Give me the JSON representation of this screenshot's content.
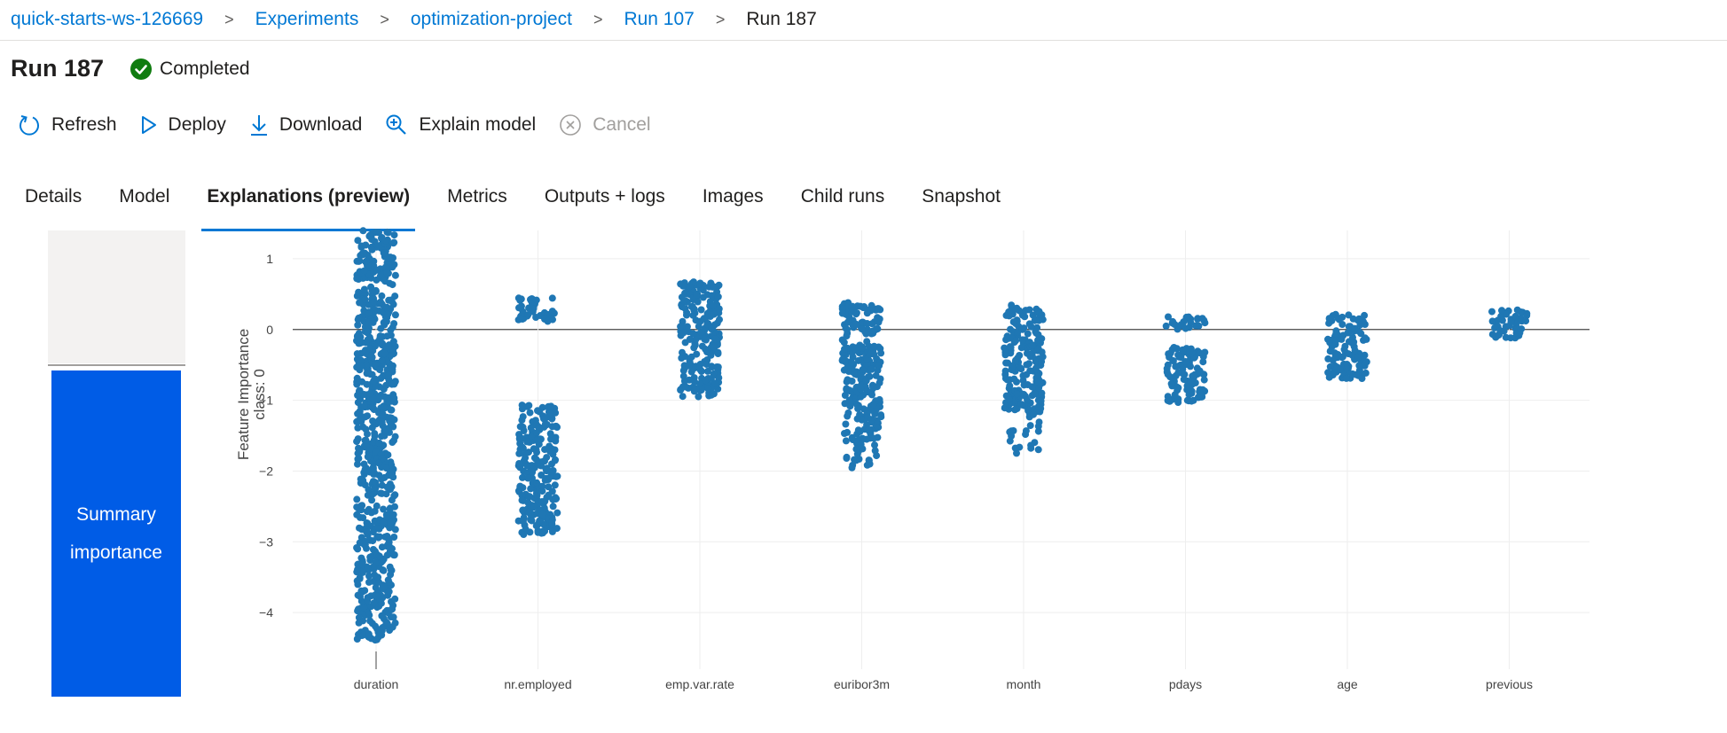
{
  "breadcrumb": {
    "items": [
      "quick-starts-ws-126669",
      "Experiments",
      "optimization-project",
      "Run 107"
    ],
    "current": "Run 187"
  },
  "header": {
    "title": "Run 187",
    "status": "Completed",
    "status_color": "#107c10"
  },
  "toolbar": {
    "refresh": "Refresh",
    "deploy": "Deploy",
    "download": "Download",
    "explain": "Explain model",
    "cancel": "Cancel"
  },
  "tabs": [
    "Details",
    "Model",
    "Explanations (preview)",
    "Metrics",
    "Outputs + logs",
    "Images",
    "Child runs",
    "Snapshot"
  ],
  "active_tab": "Explanations (preview)",
  "side_panel": {
    "button_line1": "Summary",
    "button_line2": "importance"
  },
  "chart_data": {
    "type": "scatter",
    "ylabel": "Feature Importance class: 0",
    "xlabel": "",
    "ylim": [
      -4.8,
      1.4
    ],
    "yticks": [
      1,
      0,
      -1,
      -2,
      -3,
      -4
    ],
    "grid": true,
    "point_color": "#1f77b4",
    "categories": [
      "duration",
      "nr.employed",
      "emp.var.rate",
      "euribor3m",
      "month",
      "pdays",
      "age",
      "previous"
    ],
    "distributions": [
      {
        "feature": "duration",
        "ranges": [
          [
            -4.4,
            1.4
          ]
        ]
      },
      {
        "feature": "nr.employed",
        "ranges": [
          [
            0.1,
            0.45
          ],
          [
            -2.9,
            -1.05
          ]
        ]
      },
      {
        "feature": "emp.var.rate",
        "ranges": [
          [
            -0.95,
            0.68
          ]
        ]
      },
      {
        "feature": "euribor3m",
        "ranges": [
          [
            -1.6,
            0.38
          ]
        ],
        "outliers": [
          [
            -2.05,
            -1.6
          ]
        ]
      },
      {
        "feature": "month",
        "ranges": [
          [
            -1.2,
            0.35
          ]
        ],
        "outliers": [
          [
            -1.75,
            -1.2
          ]
        ]
      },
      {
        "feature": "pdays",
        "ranges": [
          [
            0.0,
            0.18
          ],
          [
            -1.05,
            -0.25
          ]
        ]
      },
      {
        "feature": "age",
        "ranges": [
          [
            -0.7,
            0.22
          ]
        ]
      },
      {
        "feature": "previous",
        "ranges": [
          [
            -0.12,
            0.28
          ]
        ]
      }
    ]
  }
}
